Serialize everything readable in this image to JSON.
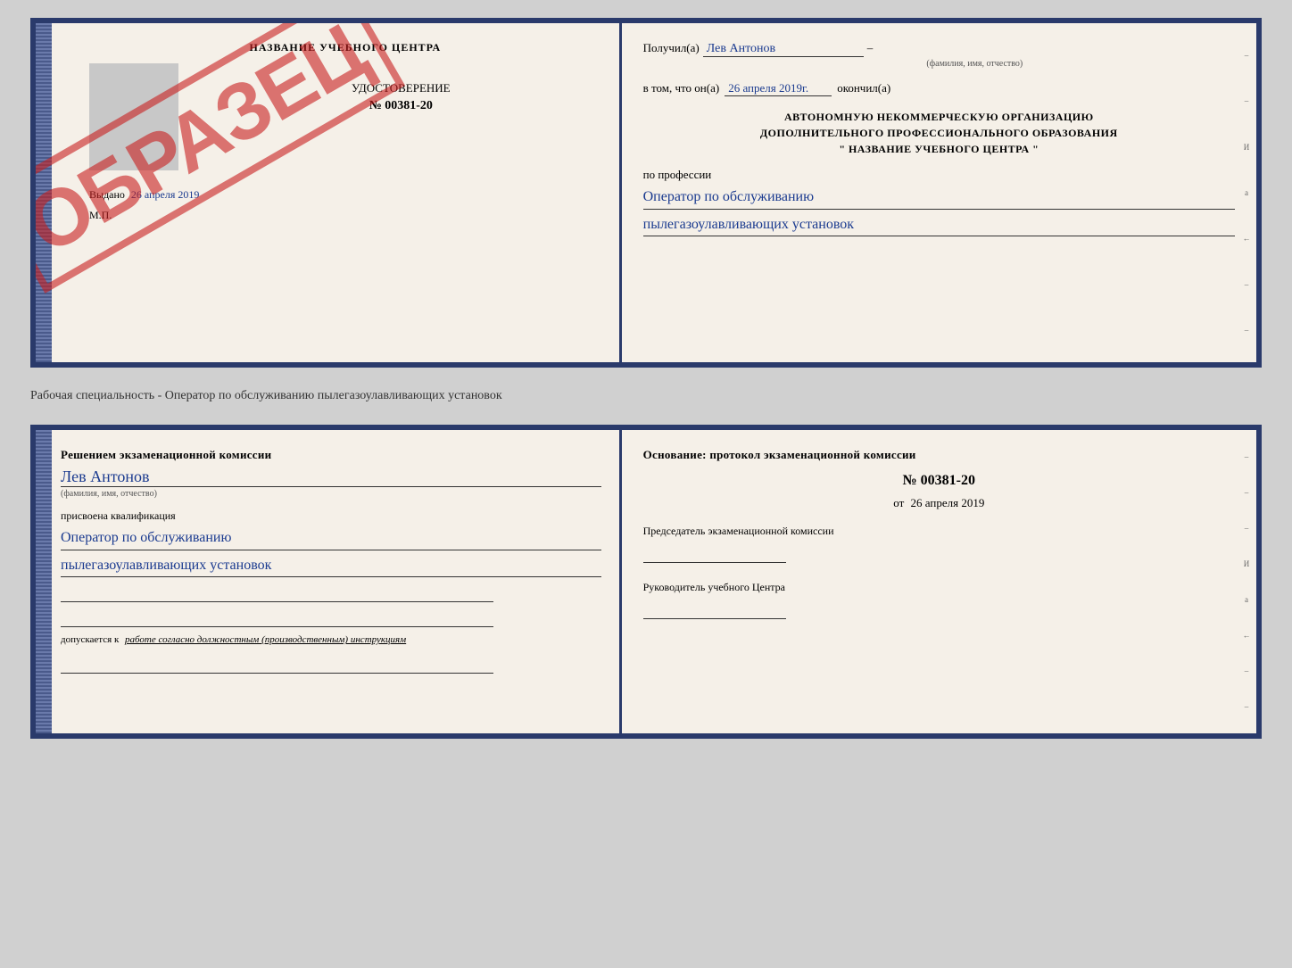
{
  "top_cert": {
    "left": {
      "header": "НАЗВАНИЕ УЧЕБНОГО ЦЕНТРА",
      "udost_label": "УДОСТОВЕРЕНИЕ",
      "number": "№ 00381-20",
      "date_label": "Выдано",
      "date_value": "26 апреля 2019",
      "mp_label": "М.П.",
      "stamp": "ОБРАЗЕЦ"
    },
    "right": {
      "poluchil_label": "Получил(а)",
      "poluchil_value": "Лев Антонов",
      "fio_sub": "(фамилия, имя, отчество)",
      "vtom_label": "в том, что он(а)",
      "vtom_value": "26 апреля 2019г.",
      "okonchil_label": "окончил(а)",
      "org_line1": "АВТОНОМНУЮ НЕКОММЕРЧЕСКУЮ ОРГАНИЗАЦИЮ",
      "org_line2": "ДОПОЛНИТЕЛЬНОГО ПРОФЕССИОНАЛЬНОГО ОБРАЗОВАНИЯ",
      "org_line3": "\"   НАЗВАНИЕ УЧЕБНОГО ЦЕНТРА   \"",
      "po_professii": "по профессии",
      "profession_line1": "Оператор по обслуживанию",
      "profession_line2": "пылегазоулавливающих установок"
    }
  },
  "separator": "Рабочая специальность - Оператор по обслуживанию пылегазоулавливающих установок",
  "bottom_cert": {
    "left": {
      "title": "Решением экзаменационной комиссии",
      "name_value": "Лев Антонов",
      "fio_label": "(фамилия, имя, отчество)",
      "kvali_label": "присвоена квалификация",
      "kvali_line1": "Оператор по обслуживанию",
      "kvali_line2": "пылегазоулавливающих установок",
      "dopusk_label": "допускается к",
      "dopusk_value": "работе согласно должностным (производственным) инструкциям"
    },
    "right": {
      "osnov_label": "Основание: протокол экзаменационной комиссии",
      "number": "№ 00381-20",
      "date_prefix": "от",
      "date_value": "26 апреля 2019",
      "pred_label": "Председатель экзаменационной комиссии",
      "ruk_label": "Руководитель учебного Центра"
    }
  },
  "side_chars": [
    "И",
    "а",
    "←",
    "–",
    "–",
    "–",
    "–",
    "–"
  ]
}
